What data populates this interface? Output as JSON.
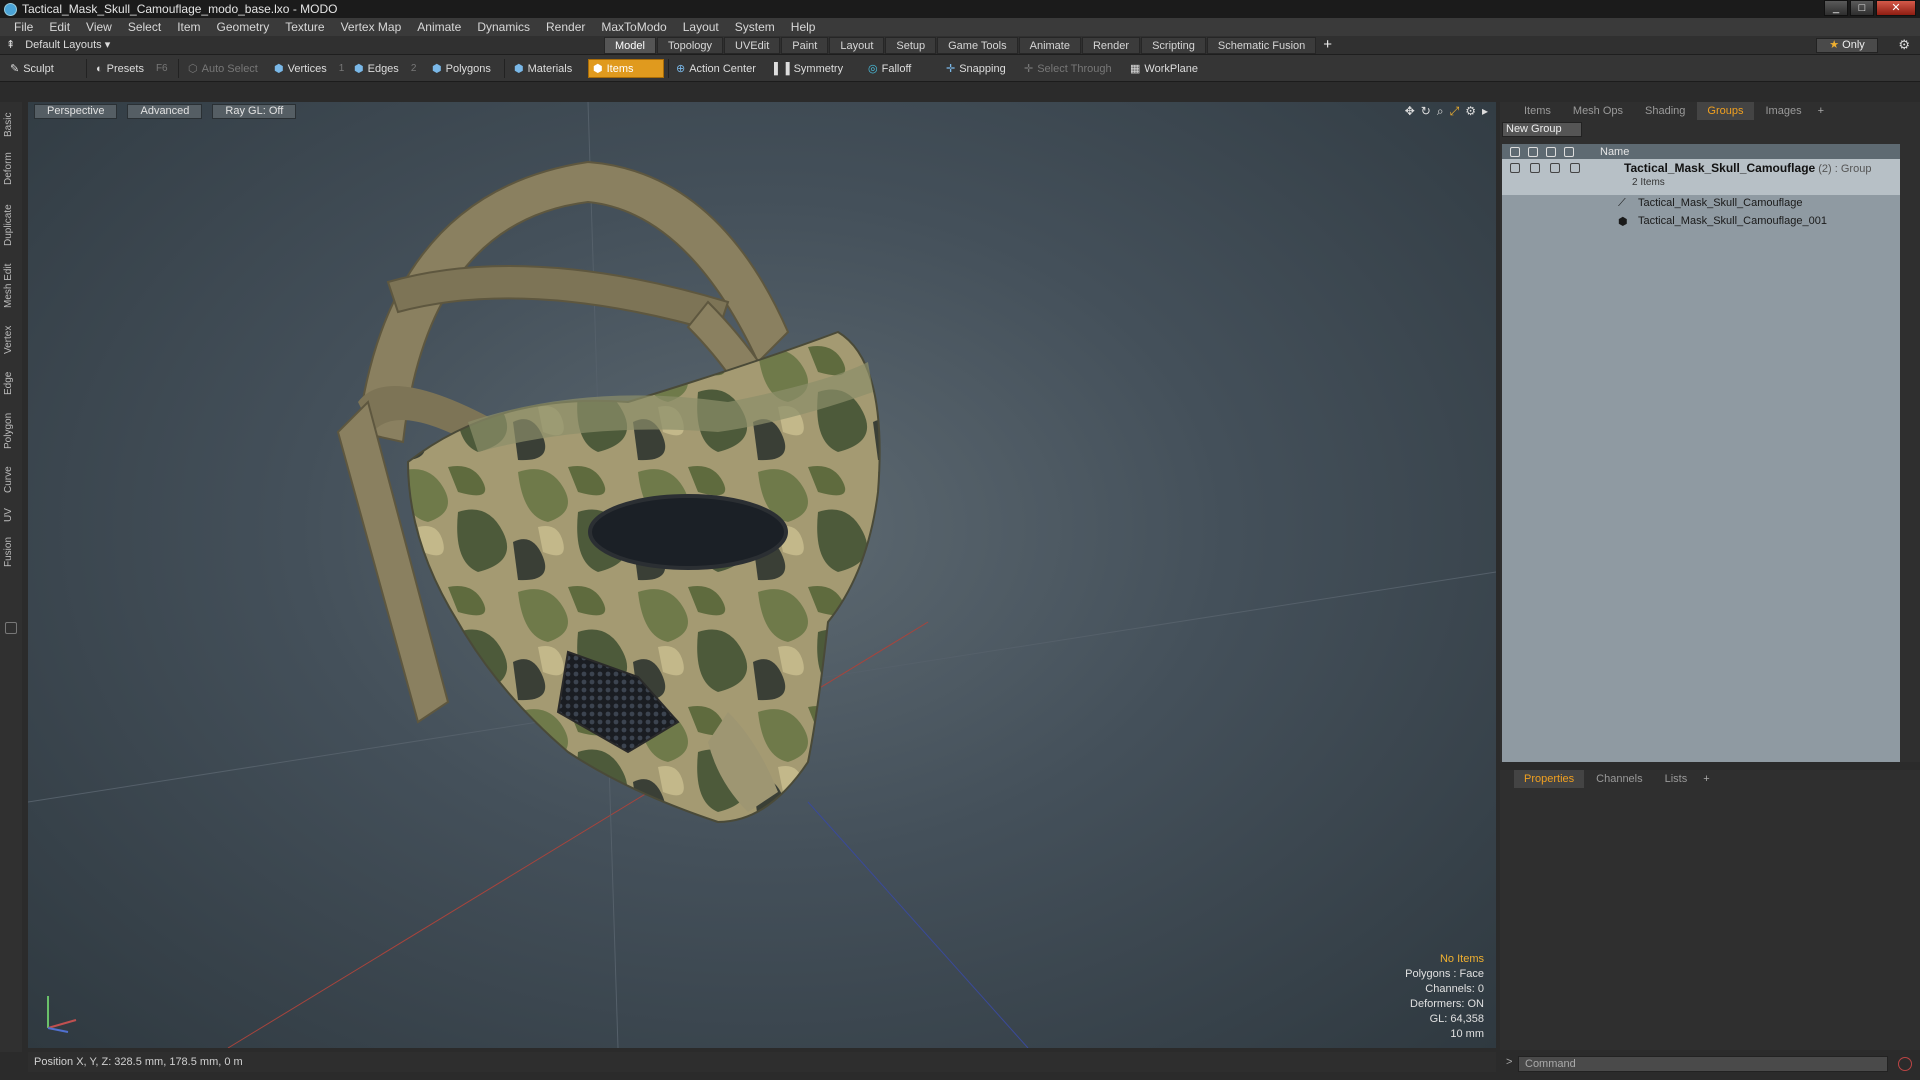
{
  "window": {
    "title": "Tactical_Mask_Skull_Camouflage_modo_base.lxo - MODO"
  },
  "menu": [
    "File",
    "Edit",
    "View",
    "Select",
    "Item",
    "Geometry",
    "Texture",
    "Vertex Map",
    "Animate",
    "Dynamics",
    "Render",
    "MaxToModo",
    "Layout",
    "System",
    "Help"
  ],
  "layout_bar": {
    "selector": "Default Layouts",
    "tabs": [
      "Model",
      "Topology",
      "UVEdit",
      "Paint",
      "Layout",
      "Setup",
      "Game Tools",
      "Animate",
      "Render",
      "Scripting",
      "Schematic Fusion"
    ],
    "active_tab": "Model",
    "only_label": "Only"
  },
  "toolbar": {
    "sculpt": "Sculpt",
    "presets": "Presets",
    "presets_key": "F6",
    "auto_select": "Auto Select",
    "vertices": "Vertices",
    "vertices_key": "1",
    "edges": "Edges",
    "edges_key": "2",
    "polygons": "Polygons",
    "materials": "Materials",
    "items": "Items",
    "action_center": "Action Center",
    "symmetry": "Symmetry",
    "falloff": "Falloff",
    "snapping": "Snapping",
    "select_through": "Select Through",
    "workplane": "WorkPlane"
  },
  "left_tabs": [
    "Basic",
    "Deform",
    "Duplicate",
    "Mesh Edit",
    "Vertex",
    "Edge",
    "Polygon",
    "Curve",
    "UV",
    "Fusion"
  ],
  "viewport": {
    "perspective": "Perspective",
    "advanced": "Advanced",
    "raygl": "Ray GL: Off",
    "info": {
      "no_items": "No Items",
      "polygons": "Polygons : Face",
      "channels": "Channels: 0",
      "deformers": "Deformers: ON",
      "gl": "GL: 64,358",
      "scale": "10 mm"
    }
  },
  "status": {
    "position": "Position X, Y, Z:   328.5 mm, 178.5 mm, 0 m"
  },
  "groups_panel": {
    "tabs": [
      "Items",
      "Mesh Ops",
      "Shading",
      "Groups",
      "Images"
    ],
    "active_tab": "Groups",
    "new_group": "New Group",
    "column_name": "Name",
    "group": {
      "name": "Tactical_Mask_Skull_Camouflage",
      "type": "(2) : Group",
      "count": "2 Items"
    },
    "children": [
      "Tactical_Mask_Skull_Camouflage",
      "Tactical_Mask_Skull_Camouflage_001"
    ]
  },
  "properties_panel": {
    "tabs": [
      "Properties",
      "Channels",
      "Lists"
    ],
    "active_tab": "Properties"
  },
  "command": {
    "placeholder": "Command"
  },
  "colors": {
    "accent": "#e09a1e",
    "active_tab_text": "#f0a020",
    "viewport_bg": "#44505a"
  }
}
